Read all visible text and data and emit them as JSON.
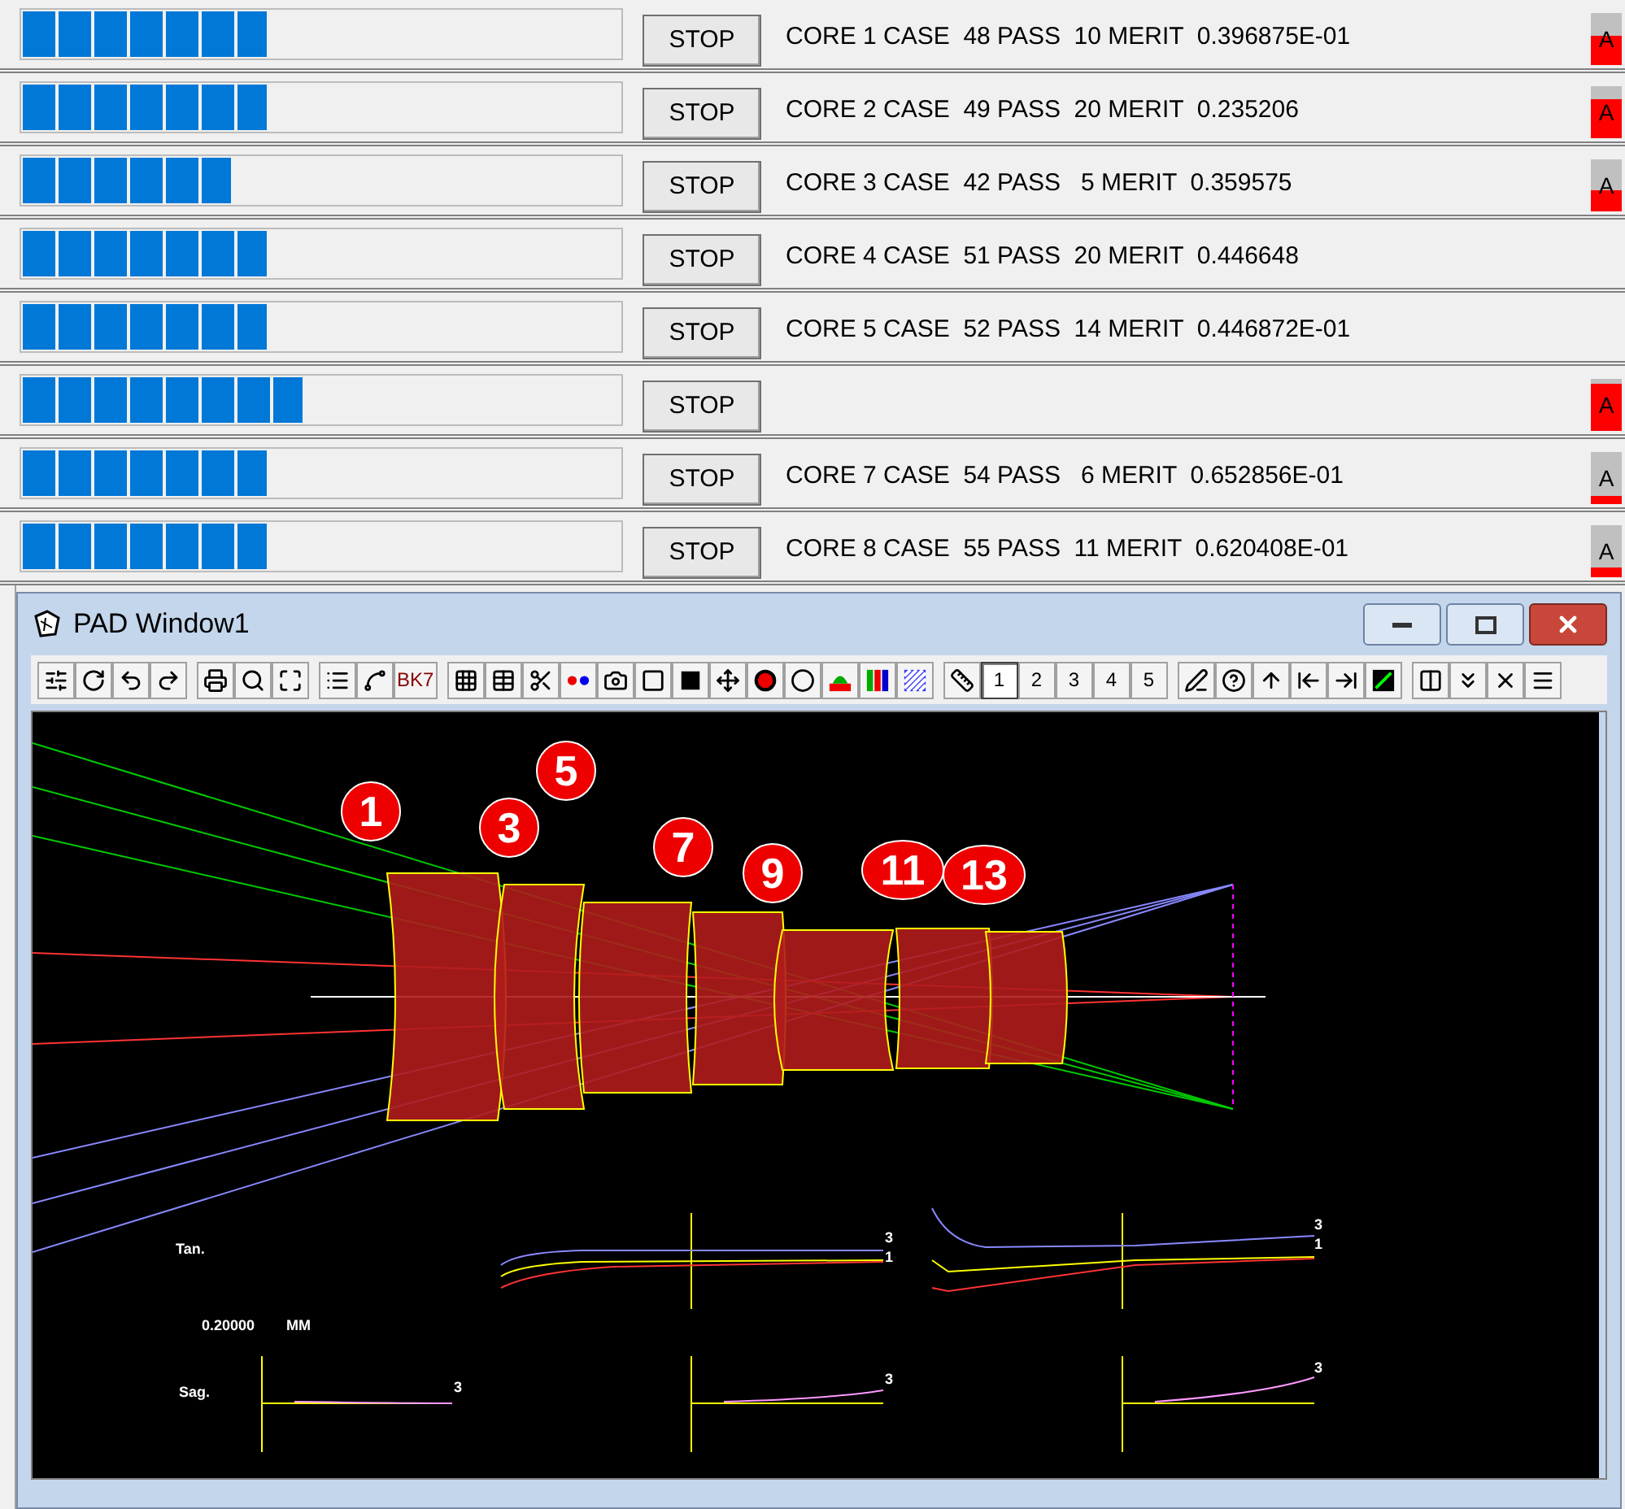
{
  "cores": [
    {
      "level": 0.41,
      "stop": "STOP",
      "status": "CORE 1 CASE  48 PASS  10 MERIT  0.396875E-01",
      "indicator": {
        "label": "A",
        "level": 0.55
      }
    },
    {
      "level": 0.41,
      "stop": "STOP",
      "status": "CORE 2 CASE  49 PASS  20 MERIT  0.235206",
      "indicator": {
        "label": "A",
        "level": 0.75
      }
    },
    {
      "level": 0.35,
      "stop": "STOP",
      "status": "CORE 3 CASE  42 PASS   5 MERIT  0.359575",
      "indicator": {
        "label": "A",
        "level": 0.42
      }
    },
    {
      "level": 0.41,
      "stop": "STOP",
      "status": "CORE 4 CASE  51 PASS  20 MERIT  0.446648"
    },
    {
      "level": 0.41,
      "stop": "STOP",
      "status": "CORE 5 CASE  52 PASS  14 MERIT  0.446872E-01"
    },
    {
      "level": 0.47,
      "stop": "STOP",
      "indicator": {
        "label": "A",
        "level": 0.9
      }
    },
    {
      "level": 0.41,
      "stop": "STOP",
      "status": "CORE 7 CASE  54 PASS   6 MERIT  0.652856E-01",
      "indicator": {
        "label": "A",
        "level": 0.15
      }
    },
    {
      "level": 0.41,
      "stop": "STOP",
      "status": "CORE 8 CASE  55 PASS  11 MERIT  0.620408E-01",
      "indicator": {
        "label": "A",
        "level": 0.2
      }
    }
  ],
  "window": {
    "title": "PAD Window1"
  },
  "toolbar": [
    [
      {
        "kind": "icon"
      },
      {
        "kind": "icon"
      },
      {
        "kind": "icon"
      },
      {
        "kind": "icon"
      }
    ],
    [
      {
        "kind": "icon"
      },
      {
        "kind": "icon"
      },
      {
        "kind": "icon"
      }
    ],
    [
      {
        "kind": "icon"
      },
      {
        "kind": "icon"
      },
      {
        "kind": "text",
        "label": "BK7",
        "selected": false
      }
    ],
    [
      {
        "kind": "icon"
      },
      {
        "kind": "icon"
      },
      {
        "kind": "icon"
      },
      {
        "kind": "icon"
      },
      {
        "kind": "icon"
      },
      {
        "kind": "icon"
      },
      {
        "kind": "icon"
      },
      {
        "kind": "icon"
      },
      {
        "kind": "icon"
      },
      {
        "kind": "icon"
      },
      {
        "kind": "icon"
      },
      {
        "kind": "icon"
      },
      {
        "kind": "icon"
      }
    ],
    [
      {
        "kind": "icon"
      },
      {
        "kind": "text",
        "label": "1",
        "selected": true
      },
      {
        "kind": "text",
        "label": "2",
        "selected": false
      },
      {
        "kind": "text",
        "label": "3",
        "selected": false
      },
      {
        "kind": "text",
        "label": "4",
        "selected": false
      },
      {
        "kind": "text",
        "label": "5",
        "selected": false
      }
    ],
    [
      {
        "kind": "icon"
      },
      {
        "kind": "icon"
      },
      {
        "kind": "icon"
      },
      {
        "kind": "icon"
      },
      {
        "kind": "icon"
      },
      {
        "kind": "icon"
      }
    ],
    [
      {
        "kind": "icon"
      },
      {
        "kind": "icon"
      },
      {
        "kind": "icon"
      },
      {
        "kind": "icon"
      }
    ]
  ],
  "lens_labels": [
    "1",
    "3",
    "5",
    "7",
    "9",
    "11",
    "13"
  ],
  "aberrations": {
    "tan_label": "Tan.",
    "scale": "0.20000",
    "unit": "MM",
    "sag_label": "Sag.",
    "tan_curve_labels": [
      [
        "3",
        "1"
      ],
      [
        "3",
        "1"
      ]
    ],
    "sag_curve_labels": [
      "3",
      "3",
      "3"
    ]
  }
}
